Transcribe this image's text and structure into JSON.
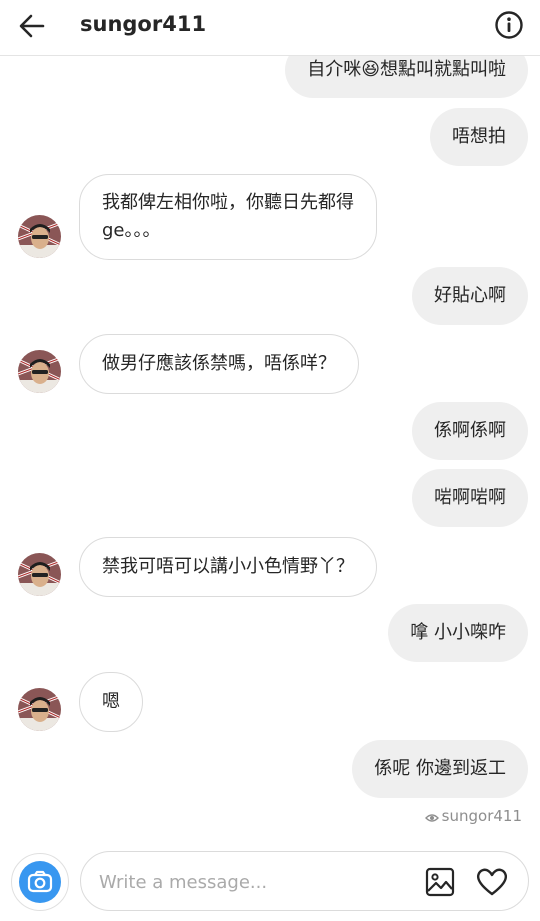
{
  "header": {
    "username": "sungor411",
    "back_icon": "arrow-left-icon",
    "info_icon": "info-icon"
  },
  "messages": [
    {
      "from": "me",
      "text": "自介咪😆想點叫就點叫啦"
    },
    {
      "from": "me",
      "text": "唔想拍"
    },
    {
      "from": "them",
      "line1": "我都俾左相你啦，你聽日先都得",
      "line2": "ge。。。"
    },
    {
      "from": "me",
      "text": "好貼心啊"
    },
    {
      "from": "them",
      "text": "做男仔應該係禁嗎，唔係咩？"
    },
    {
      "from": "me",
      "text": "係啊係啊"
    },
    {
      "from": "me",
      "text": "啱啊啱啊"
    },
    {
      "from": "them",
      "text": "禁我可唔可以講小小色情野丫？"
    },
    {
      "from": "me",
      "text": "嗱 小小㗎咋"
    },
    {
      "from": "them",
      "text": "嗯"
    },
    {
      "from": "me",
      "text": "係呢 你邊到返工"
    }
  ],
  "seen": {
    "label": "sungor411",
    "icon": "eye-icon"
  },
  "composer": {
    "placeholder": "Write a message...",
    "camera_icon": "camera-icon",
    "gallery_icon": "gallery-icon",
    "heart_icon": "heart-icon",
    "accent": "#3897f0"
  }
}
